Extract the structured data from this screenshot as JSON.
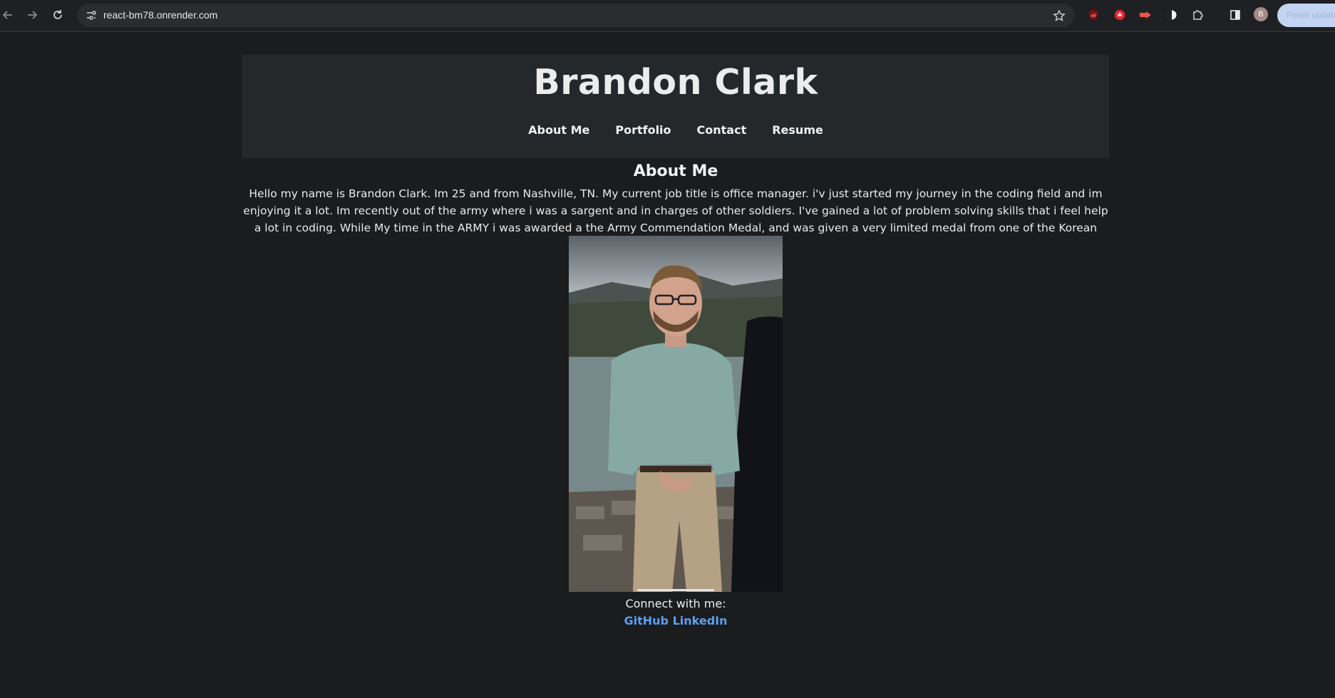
{
  "browser": {
    "url": "react-bm78.onrender.com",
    "avatar_initial": "B",
    "update_button_label": "Finish update",
    "icons": [
      "back-icon",
      "forward-icon",
      "reload-icon",
      "site-settings-icon",
      "bookmark-star-icon",
      "ublock-icon",
      "adblock-icon",
      "video-ext-icon",
      "dark-mode-ext-icon",
      "puzzle-extensions-icon",
      "side-panel-icon"
    ]
  },
  "header": {
    "title": "Brandon Clark",
    "nav": [
      "About Me",
      "Portfolio",
      "Contact",
      "Resume"
    ]
  },
  "about": {
    "heading": "About Me",
    "bio": "Hello my name is Brandon Clark. Im 25 and from Nashville, TN. My current job title is office manager. i'v just started my journey in the coding field and im enjoying it a lot. Im recently out of the army where i was a sargent and in charges of other soldiers. I've gained a lot of problem solving skills that i feel help a lot in coding. While My time in the ARMY i was awarded a the Army Commendation Medal, and was given a very limited medal from one of the Korean ARMYs sargent majors."
  },
  "footer": {
    "connect_label": "Connect with me:",
    "links": [
      "GitHub",
      "LinkedIn"
    ]
  },
  "colors": {
    "page_bg": "#1b1c1e",
    "header_bg": "#25282a",
    "link": "#5c9ff0"
  }
}
